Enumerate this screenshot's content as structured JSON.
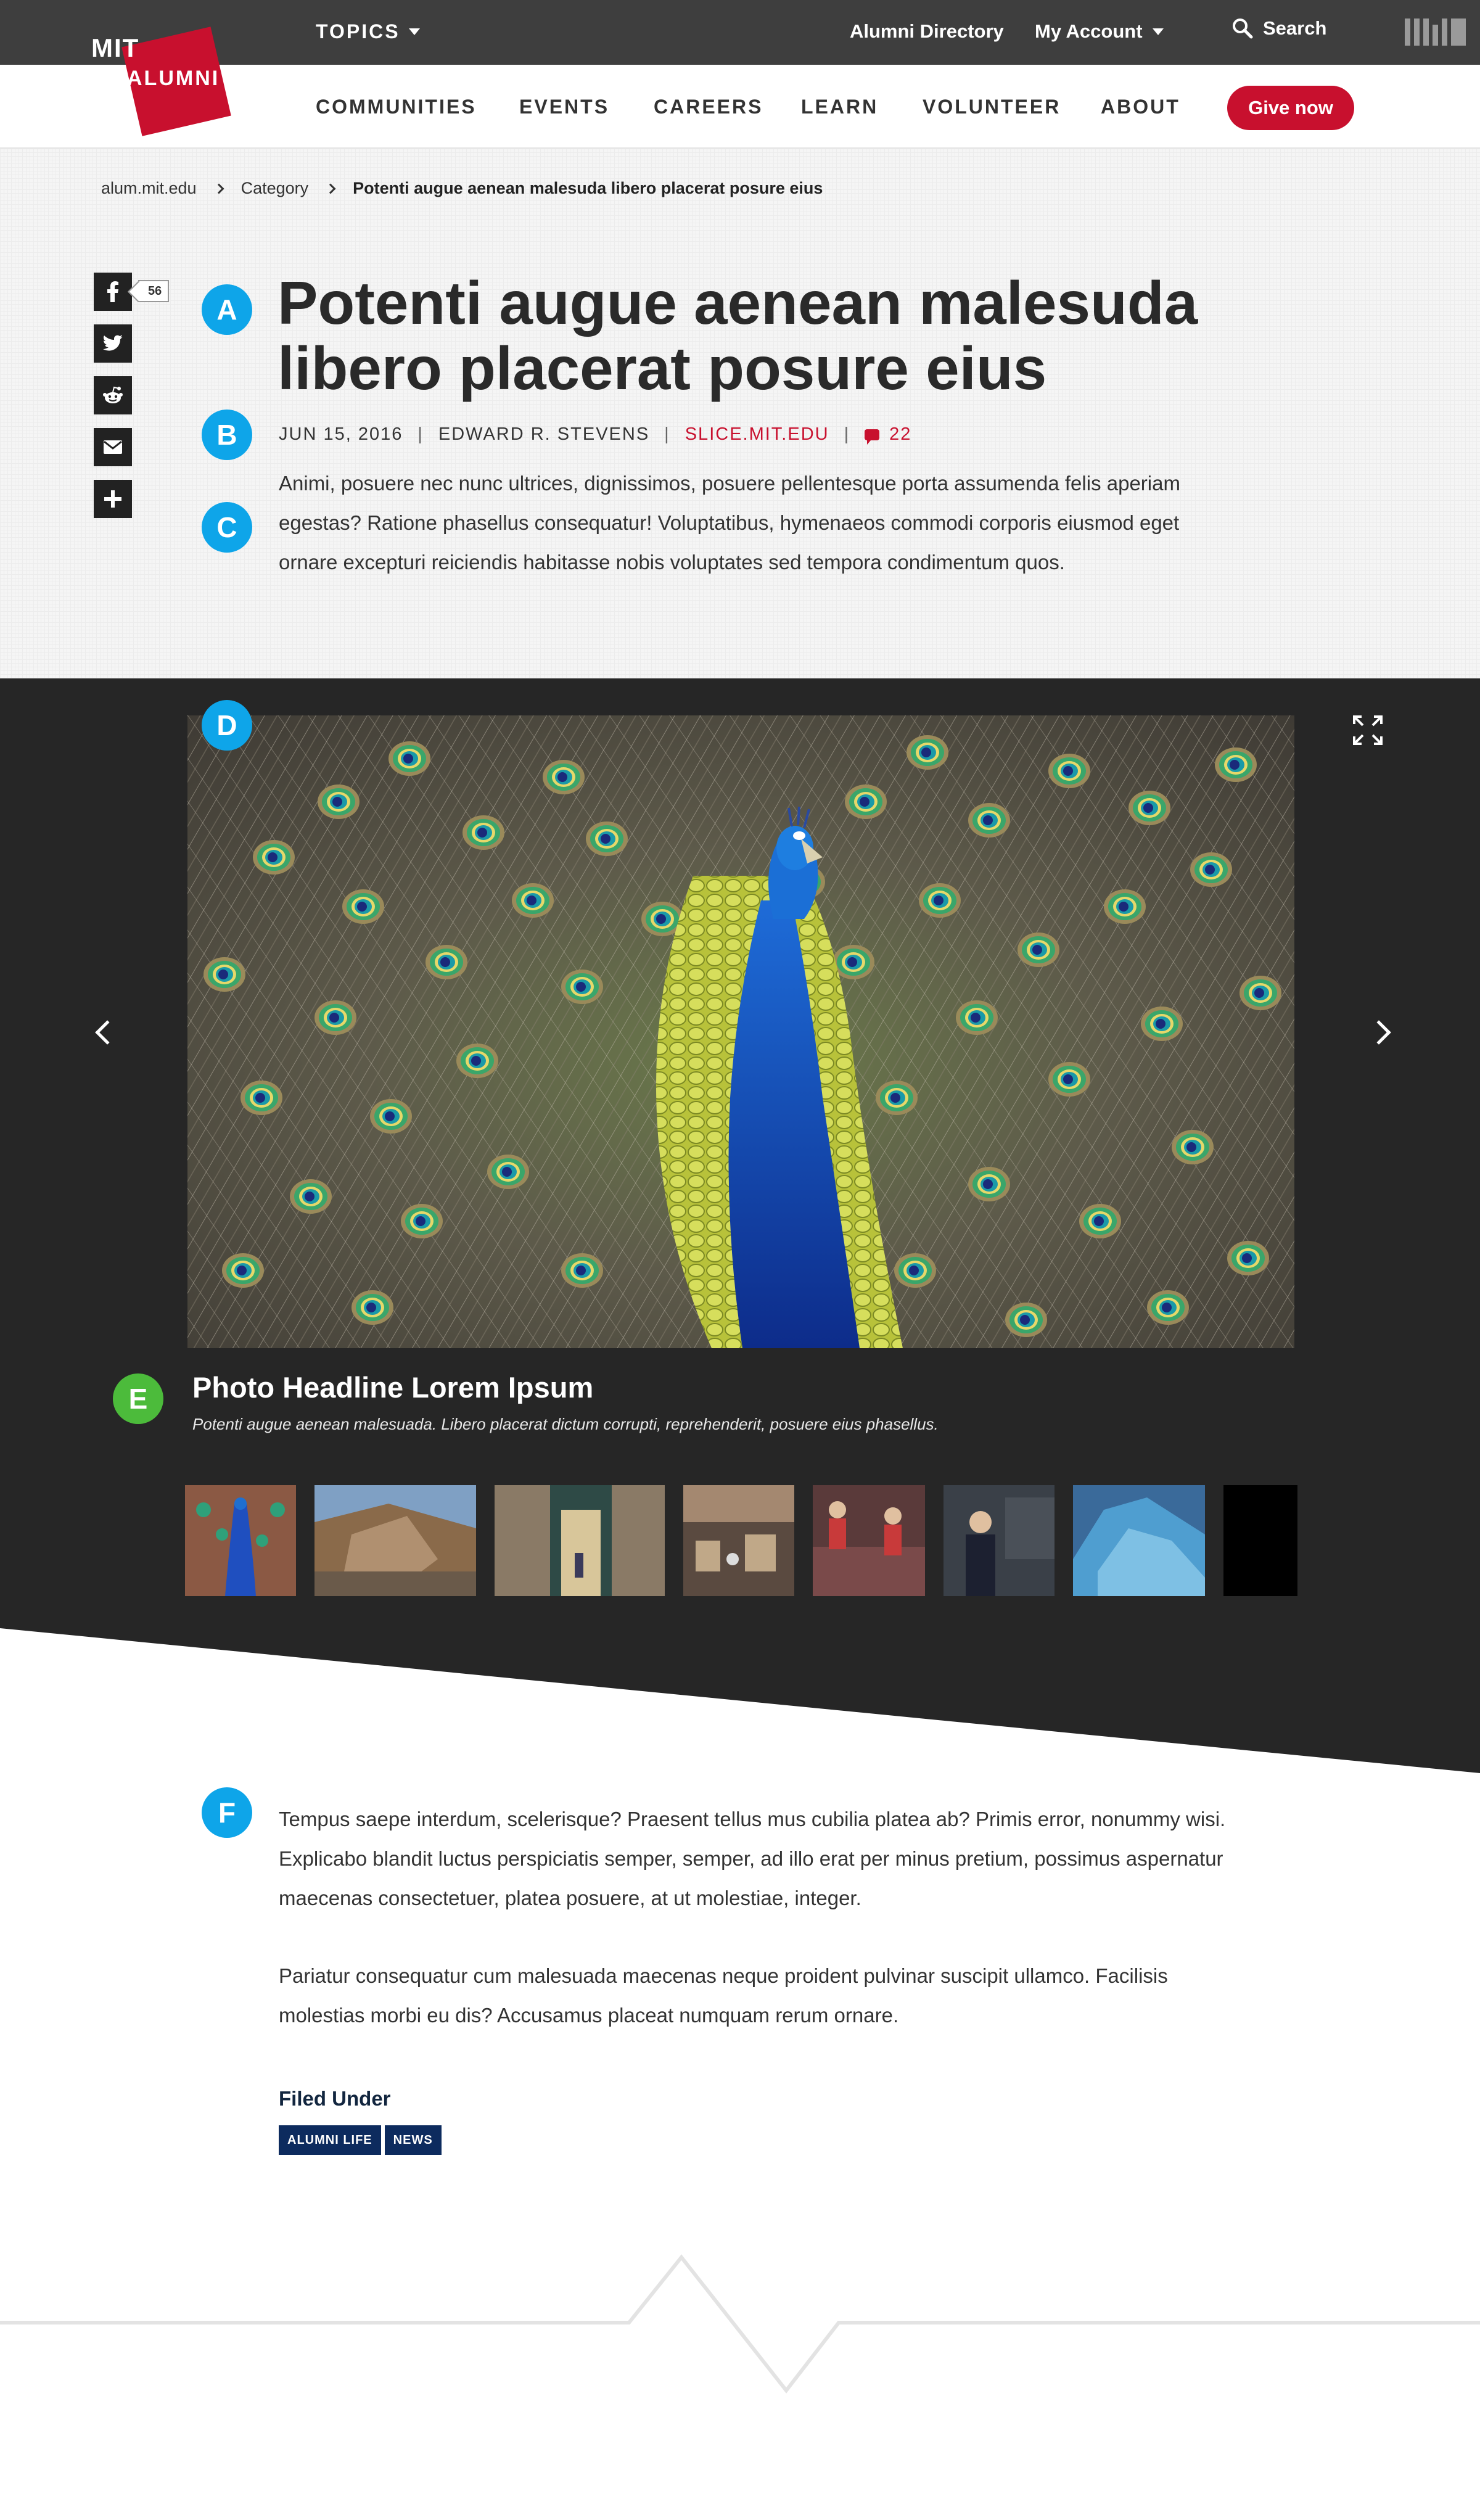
{
  "utility_bar": {
    "topics_label": "TOPICS",
    "alumni_directory": "Alumni Directory",
    "my_account": "My Account",
    "search_label": "Search"
  },
  "logo": {
    "mit": "MIT",
    "alumni": "ALUMNI"
  },
  "main_nav": {
    "items": [
      "COMMUNITIES",
      "EVENTS",
      "CAREERS",
      "LEARN",
      "VOLUNTEER",
      "ABOUT"
    ],
    "give_label": "Give now"
  },
  "breadcrumb": {
    "items": [
      "alum.mit.edu",
      "Category",
      "Potenti augue aenean malesuda libero placerat posure eius"
    ]
  },
  "share": {
    "facebook_count": "56"
  },
  "markers": [
    "A",
    "B",
    "C",
    "D",
    "E",
    "F"
  ],
  "article": {
    "title": "Potenti augue aenean malesuda libero placerat posure eius",
    "date": "JUN 15, 2016",
    "author": "EDWARD R. STEVENS",
    "source": "SLICE.MIT.EDU",
    "comment_count": "22",
    "intro": "Animi, posuere nec nunc ultrices, dignissimos, posuere pellentesque porta assumenda felis aperiam egestas? Ratione phasellus consequatur! Voluptatibus, hymenaeos commodi corporis eiusmod eget ornare excepturi reiciendis habitasse nobis voluptates sed tempora condimentum quos."
  },
  "gallery": {
    "photo_headline": "Photo Headline Lorem Ipsum",
    "photo_caption": "Potenti augue aenean malesuada. Libero placerat dictum corrupti, reprehenderit, posuere eius phasellus."
  },
  "body": {
    "paragraphs": [
      "Tempus saepe interdum, scelerisque? Praesent tellus mus cubilia platea ab? Primis error, nonummy wisi. Explicabo blandit luctus perspiciatis semper, semper, ad illo erat per minus pretium, possimus aspernatur maecenas consectetuer, platea posuere, at ut molestiae, integer.",
      "Pariatur consequatur cum malesuada maecenas neque proident pulvinar suscipit ullamco. Facilisis molestias morbi eu dis? Accusamus placeat numquam rerum ornare."
    ],
    "filed_under_label": "Filed Under",
    "tags": [
      "ALUMNI LIFE",
      "NEWS"
    ]
  },
  "colors": {
    "brand_red": "#c8102e",
    "marker_blue": "#0ea5e9",
    "marker_green": "#4cbb3b",
    "gallery_bg": "#262626",
    "tag_navy": "#0d2b5e"
  },
  "icons": [
    "facebook-icon",
    "twitter-icon",
    "reddit-icon",
    "email-icon",
    "plus-icon",
    "search-icon",
    "expand-icon",
    "chevron-left-icon",
    "chevron-right-icon",
    "comment-icon",
    "mit-logo-icon"
  ]
}
